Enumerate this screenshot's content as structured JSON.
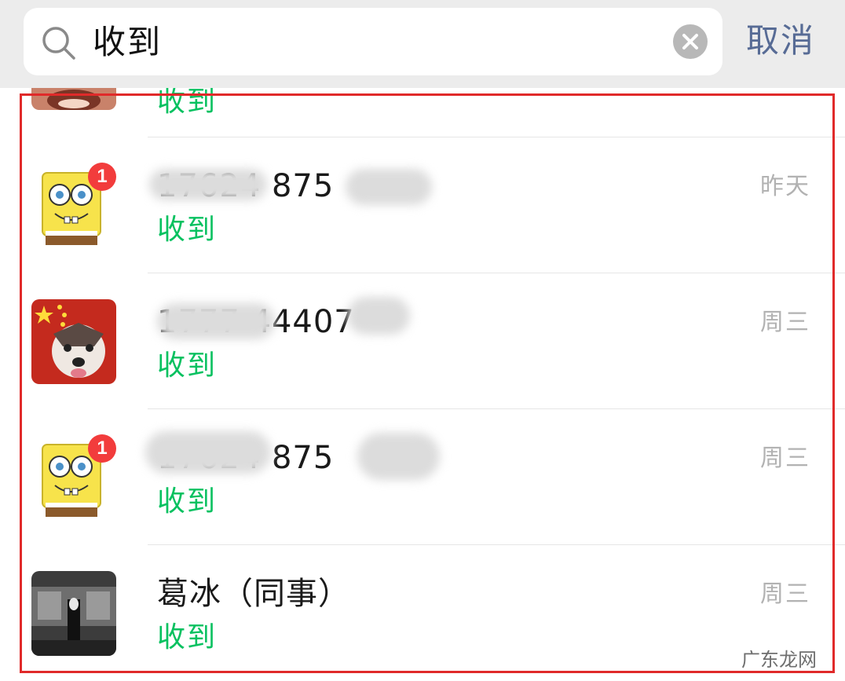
{
  "search": {
    "query": "收到",
    "cancel_label": "取消"
  },
  "results": [
    {
      "name": "",
      "snippet": "收到",
      "time": ""
    },
    {
      "name": "17624  875",
      "snippet": "收到",
      "time": "昨天",
      "badge": "1"
    },
    {
      "name": "1777  44407",
      "snippet": "收到",
      "time": "周三"
    },
    {
      "name": "17624  875",
      "snippet": "收到",
      "time": "周三",
      "badge": "1"
    },
    {
      "name": "葛冰（同事）",
      "snippet": "收到",
      "time": "周三"
    }
  ],
  "watermark": "广东龙网",
  "colors": {
    "snippet_green": "#07c160",
    "cancel_blue": "#576b95",
    "highlight_red": "#e02a2a",
    "badge_red": "#f23c3c"
  }
}
